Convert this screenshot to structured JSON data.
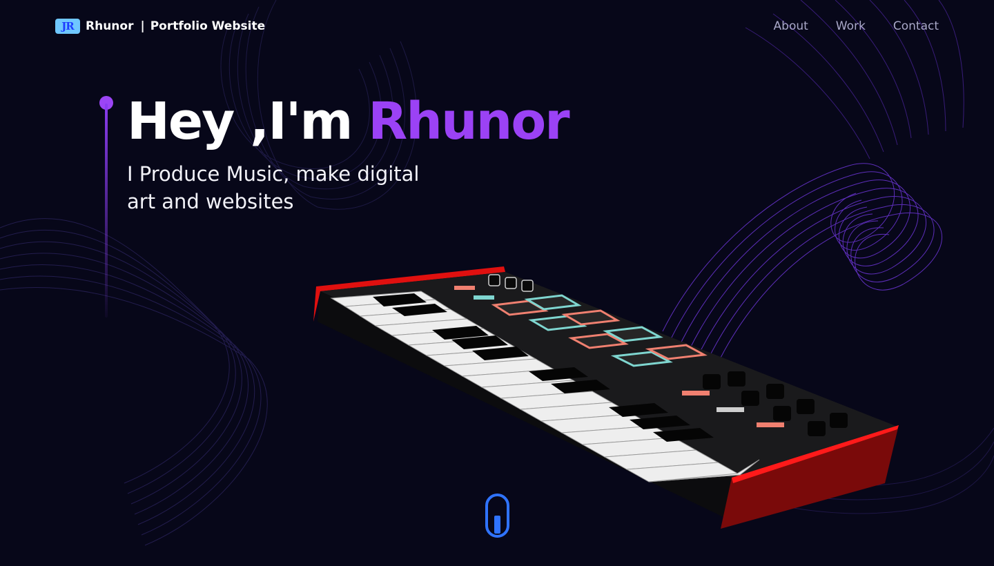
{
  "brand": {
    "logo": "JR",
    "name": "Rhunor",
    "separator": "|",
    "subtitle": "Portfolio Website"
  },
  "nav": {
    "items": [
      {
        "label": "About"
      },
      {
        "label": "Work"
      },
      {
        "label": "Contact"
      }
    ]
  },
  "hero": {
    "greeting": "Hey ,I'm ",
    "name": "Rhunor",
    "subtitle_line1": "I Produce Music, make digital",
    "subtitle_line2": "art and websites"
  },
  "colors": {
    "background": "#070719",
    "accent": "#9b42f5",
    "nav_text": "#a9a8c8",
    "scroll_blue": "#2f73ff",
    "keyboard_red": "#e0100f",
    "pad_teal": "#7fd6d0",
    "pad_salmon": "#f08070"
  },
  "icons": {
    "scroll": "mouse-scroll-icon",
    "keyboard": "midi-keyboard-illustration"
  }
}
